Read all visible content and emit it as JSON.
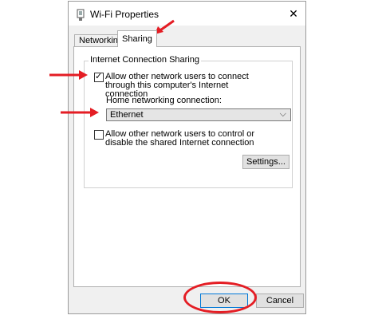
{
  "window": {
    "title": "Wi-Fi Properties",
    "close_glyph": "✕",
    "icon": "wifi-adapter-icon"
  },
  "tabs": [
    {
      "label": "Networking"
    },
    {
      "label": "Sharing"
    }
  ],
  "ics": {
    "group_title": "Internet Connection Sharing",
    "allow_connect": {
      "label": "Allow other network users to connect through this computer's Internet connection",
      "checked": true,
      "mark": "✓"
    },
    "home_label": "Home networking connection:",
    "home_select": {
      "value": "Ethernet",
      "arrow": "⌵"
    },
    "allow_control": {
      "label": "Allow other network users to control or disable the shared Internet connection",
      "checked": false
    },
    "settings_label": "Settings..."
  },
  "buttons": {
    "ok": "OK",
    "cancel": "Cancel"
  },
  "annotation_color": "#e41d24"
}
